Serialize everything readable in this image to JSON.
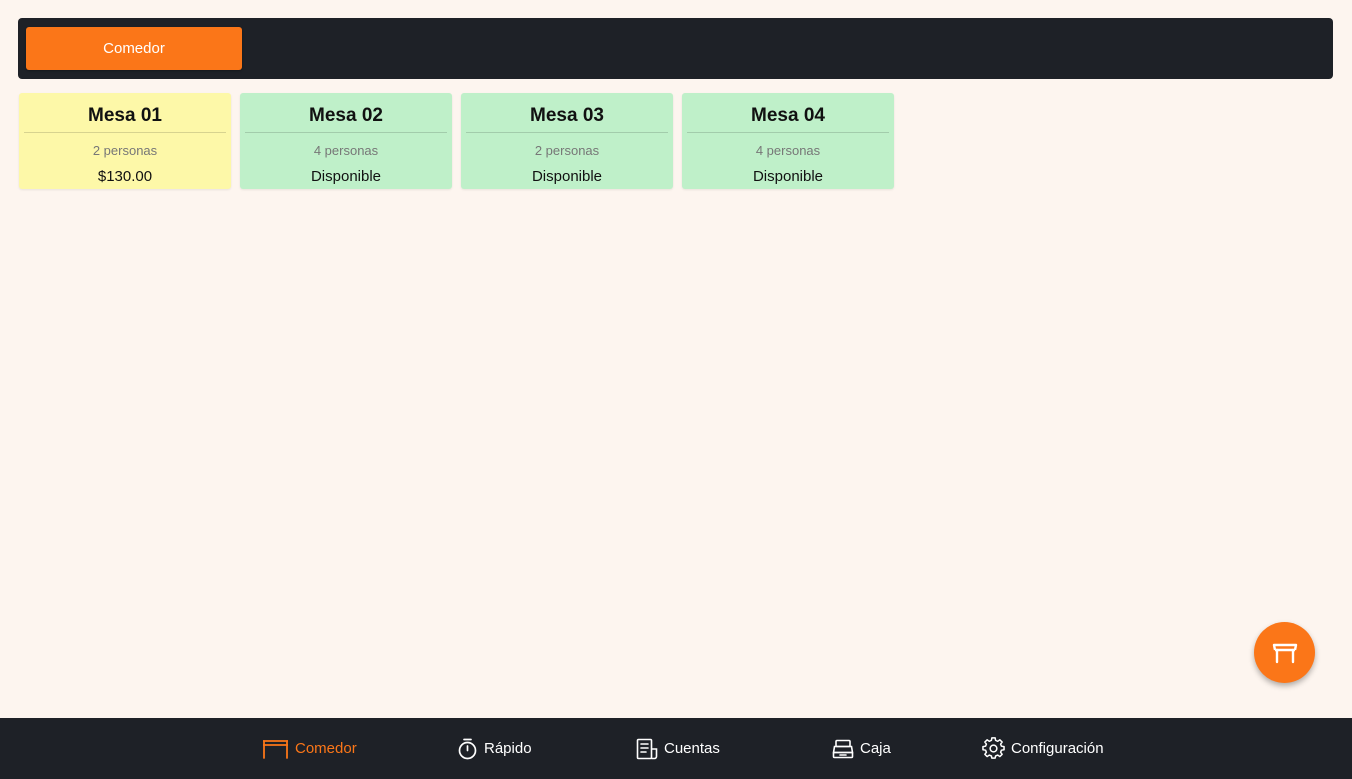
{
  "top_bar": {
    "zones": [
      {
        "label": "Comedor",
        "active": true
      }
    ]
  },
  "tables": [
    {
      "name": "Mesa 01",
      "capacity": "2 personas",
      "status": "$130.00",
      "state": "occupied"
    },
    {
      "name": "Mesa 02",
      "capacity": "4 personas",
      "status": "Disponible",
      "state": "free"
    },
    {
      "name": "Mesa 03",
      "capacity": "2 personas",
      "status": "Disponible",
      "state": "free"
    },
    {
      "name": "Mesa 04",
      "capacity": "4 personas",
      "status": "Disponible",
      "state": "free"
    }
  ],
  "fab": {
    "icon": "table-icon"
  },
  "bottom_nav": {
    "items": [
      {
        "label": "Comedor",
        "icon": "table-icon",
        "active": true
      },
      {
        "label": "Rápido",
        "icon": "stopwatch-icon",
        "active": false
      },
      {
        "label": "Cuentas",
        "icon": "receipt-icon",
        "active": false
      },
      {
        "label": "Caja",
        "icon": "cash-register-icon",
        "active": false
      },
      {
        "label": "Configuración",
        "icon": "gear-icon",
        "active": false
      }
    ]
  },
  "colors": {
    "accent": "#fb7618",
    "dark_bar": "#1e2127",
    "background": "#fdf5ef",
    "occupied": "#fdf8a8",
    "available": "#bff0c9"
  }
}
